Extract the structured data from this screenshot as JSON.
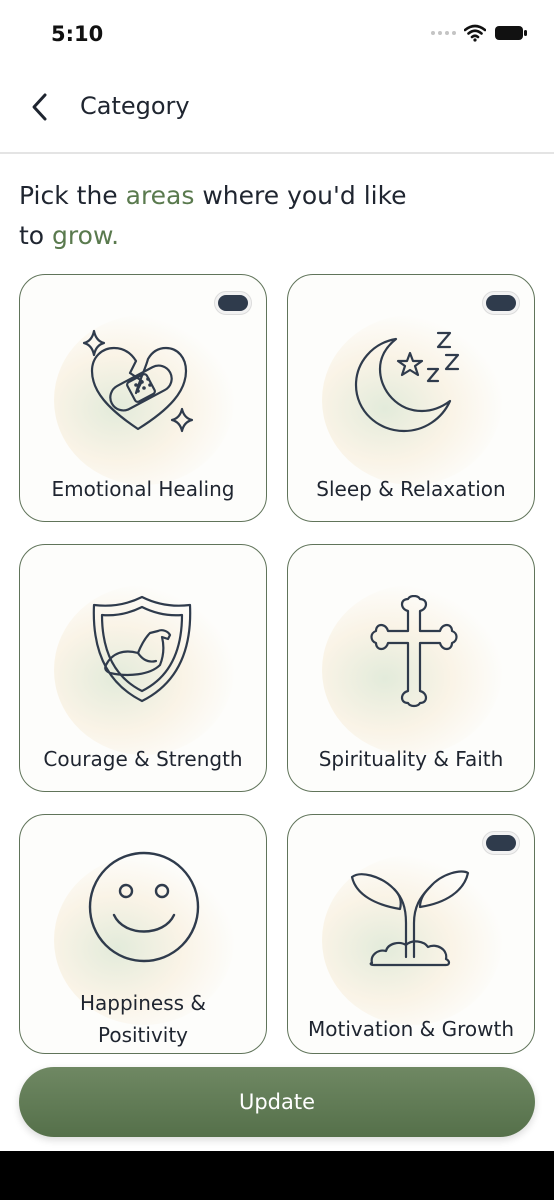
{
  "status": {
    "time": "5:10"
  },
  "nav": {
    "title": "Category"
  },
  "prompt": {
    "part1": "Pick the ",
    "accent1": "areas",
    "part2": " where you'd like to ",
    "accent2": "grow."
  },
  "categories": [
    {
      "label": "Emotional Healing",
      "selected": true,
      "icon": "bandaged-heart-icon"
    },
    {
      "label": "Sleep & Relaxation",
      "selected": true,
      "icon": "moon-sleep-icon"
    },
    {
      "label": "Courage & Strength",
      "selected": false,
      "icon": "shield-muscle-icon"
    },
    {
      "label": "Spirituality & Faith",
      "selected": false,
      "icon": "cross-icon"
    },
    {
      "label": "Happiness & Positivity",
      "selected": false,
      "icon": "smiley-icon"
    },
    {
      "label": "Motivation & Growth",
      "selected": true,
      "icon": "sprout-icon"
    }
  ],
  "update_button": {
    "label": "Update"
  },
  "colors": {
    "accent": "#5a7a4e",
    "button": "#62795a",
    "card_border": "#60745a",
    "toggle_on": "#2f3b4c"
  }
}
